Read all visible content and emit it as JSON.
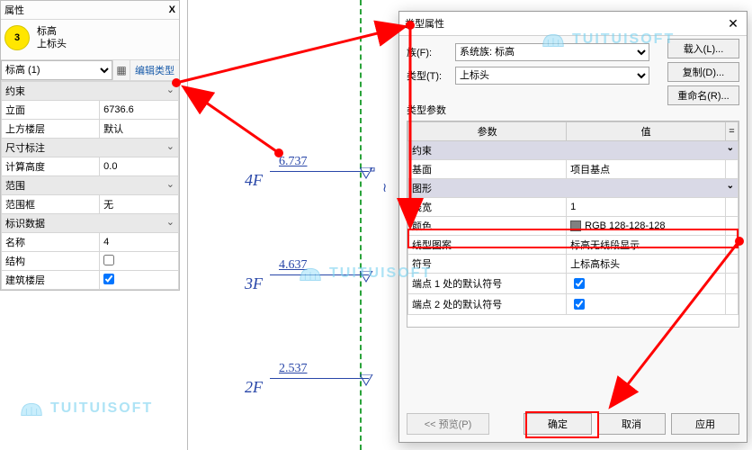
{
  "panel": {
    "title": "属性",
    "close": "X",
    "badge": "3",
    "typeLine1": "标高",
    "typeLine2": "上标头",
    "selector": "标高 (1)",
    "editType": "编辑类型",
    "sections": {
      "constraint": "约束",
      "dim": "尺寸标注",
      "scope": "范围",
      "ident": "标识数据"
    },
    "rows": {
      "elev_l": "立面",
      "elev_v": "6736.6",
      "upper_l": "上方楼层",
      "upper_v": "默认",
      "calc_l": "计算高度",
      "calc_v": "0.0",
      "scope_l": "范围框",
      "scope_v": "无",
      "name_l": "名称",
      "name_v": "4",
      "struct_l": "结构",
      "story_l": "建筑楼层"
    }
  },
  "levels": {
    "l4_tag": "4F",
    "l4_elev": "6.737",
    "l3_tag": "3F",
    "l3_elev": "4.637",
    "l2_tag": "2F",
    "l2_elev": "2.537"
  },
  "dlg": {
    "title": "类型属性",
    "family_l": "族(F):",
    "family_v": "系统族: 标高",
    "type_l": "类型(T):",
    "type_v": "上标头",
    "btn_load": "载入(L)...",
    "btn_dup": "复制(D)...",
    "btn_rename": "重命名(R)...",
    "param_caption": "类型参数",
    "th_param": "参数",
    "th_value": "值",
    "cat_constraint": "约束",
    "base_l": "基面",
    "base_v": "项目基点",
    "cat_graphics": "图形",
    "lw_l": "线宽",
    "lw_v": "1",
    "color_l": "颜色",
    "color_v": "RGB 128-128-128",
    "pattern_l": "线型图案",
    "pattern_v": "标高无线段显示",
    "symbol_l": "符号",
    "symbol_v": "上标高标头",
    "end1_l": "端点 1 处的默认符号",
    "end2_l": "端点 2 处的默认符号",
    "btn_preview": "<< 预览(P)",
    "btn_ok": "确定",
    "btn_cancel": "取消",
    "btn_apply": "应用"
  },
  "wm": "TUITUISOFT",
  "chart_data": {
    "type": "table",
    "title": "类型参数",
    "rows": [
      {
        "param": "基面",
        "value": "项目基点",
        "group": "约束"
      },
      {
        "param": "线宽",
        "value": "1",
        "group": "图形"
      },
      {
        "param": "颜色",
        "value": "RGB 128-128-128",
        "group": "图形"
      },
      {
        "param": "线型图案",
        "value": "标高无线段显示",
        "group": "图形"
      },
      {
        "param": "符号",
        "value": "上标高标头",
        "group": "图形"
      },
      {
        "param": "端点 1 处的默认符号",
        "value": true,
        "group": "图形"
      },
      {
        "param": "端点 2 处的默认符号",
        "value": true,
        "group": "图形"
      }
    ]
  }
}
